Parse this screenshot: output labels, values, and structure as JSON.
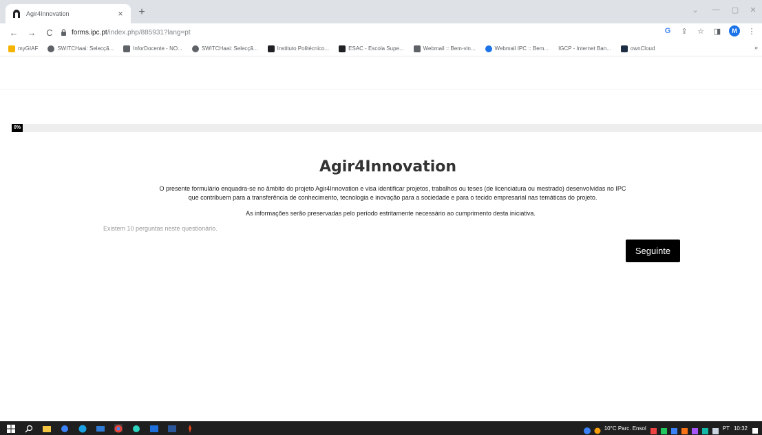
{
  "browser": {
    "tab": {
      "title": "Agir4Innovation",
      "close": "×"
    },
    "new_tab": "+",
    "window_controls": {
      "minimize": "—",
      "restore": "▢",
      "close": "✕",
      "dropdown": "⌄"
    },
    "nav": {
      "back": "←",
      "forward": "→",
      "reload": "C"
    },
    "url": {
      "domain": "forms.ipc.pt",
      "path": "/index.php/885931?lang=pt"
    },
    "toolbar_icons": {
      "google": "G",
      "share": "⇪",
      "star": "☆",
      "sidepanel": "◨",
      "menu": "⋮",
      "profile_initial": "M"
    },
    "bookmarks": [
      {
        "label": "myGIAF",
        "icon": "puzzle-icon",
        "color": "#f4b400"
      },
      {
        "label": "SWITCHaai: Selecçã...",
        "icon": "switch-icon",
        "color": "#5f6368"
      },
      {
        "label": "InforDocente - NO...",
        "icon": "infor-icon",
        "color": "#5f6368"
      },
      {
        "label": "SWITCHaai: Selecçã...",
        "icon": "switch-icon",
        "color": "#5f6368"
      },
      {
        "label": "Instituto Politécnico...",
        "icon": "ipc-icon",
        "color": "#202124"
      },
      {
        "label": "ESAC - Escola Supe...",
        "icon": "ipc-icon",
        "color": "#202124"
      },
      {
        "label": "Webmail :: Bem-vin...",
        "icon": "webmail-icon",
        "color": "#5f6368"
      },
      {
        "label": "Webmail IPC :: Bem...",
        "icon": "webmail-ipc-icon",
        "color": "#1a73e8"
      },
      {
        "label": "IGCP - Internet Ban...",
        "icon": "",
        "color": "#5f6368"
      },
      {
        "label": "ownCloud",
        "icon": "owncloud-icon",
        "color": "#1d2d44"
      }
    ],
    "bookmarks_more": "»"
  },
  "survey": {
    "progress_label": "0%",
    "progress_value": 0,
    "title": "Agir4Innovation",
    "description_line1": "O presente formulário enquadra-se no âmbito do projeto Agir4Innovation e visa identificar projetos, trabalhos ou teses (de licenciatura ou mestrado) desenvolvidas no IPC",
    "description_line2": "que contribuem para a transferência de conhecimento, tecnologia e inovação para a sociedade e para o tecido empresarial nas temáticas do projeto.",
    "description_line3": "As informações serão preservadas pelo período estritamente necessário ao cumprimento desta iniciativa.",
    "question_count": "Existem 10 perguntas neste questionário.",
    "next_button": "Seguinte"
  },
  "taskbar": {
    "weather": "10°C  Parc. Ensol",
    "time": "10:32",
    "lang": "PT"
  },
  "colors": {
    "accent": "#000000",
    "tabbar": "#dee1e6",
    "taskbar": "#1f1f1f"
  }
}
